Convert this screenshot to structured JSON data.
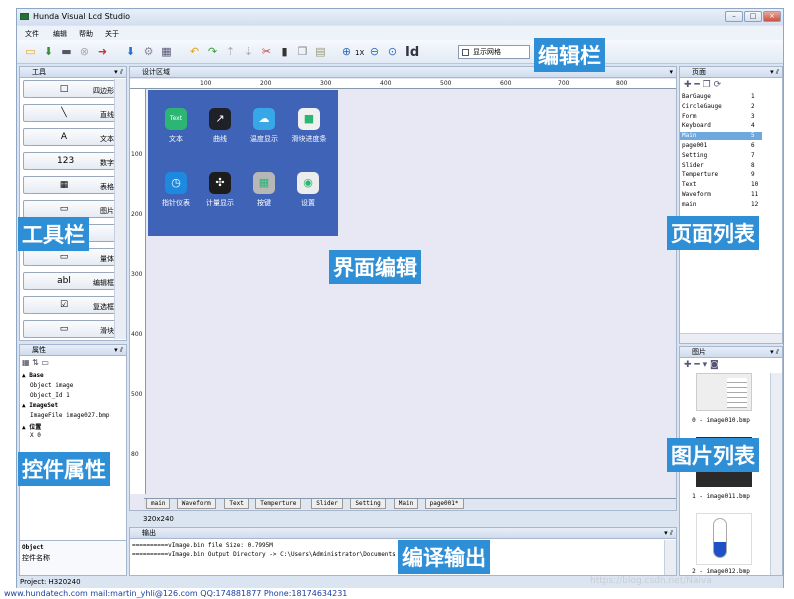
{
  "window": {
    "title": "Hunda Visual Lcd Studio",
    "controls": {
      "minimize": "–",
      "maximize": "□",
      "close": "×"
    }
  },
  "menu": [
    "文件",
    "编辑",
    "帮助",
    "关于"
  ],
  "toolbar": {
    "icons": [
      "new-icon",
      "open-icon",
      "save-icon",
      "close-file-icon",
      "exit-icon",
      "download-icon",
      "settings-icon",
      "calc-icon",
      "undo-icon",
      "redo-icon",
      "move-up-icon",
      "move-down-icon",
      "cut-icon",
      "delete-icon",
      "copy-icon",
      "paste-icon",
      "zoom-in-icon",
      "zoom-reset-icon",
      "zoom-out-icon",
      "zoom-icon",
      "id-icon"
    ],
    "zoom_1x_label": "1X",
    "id_label": "Id",
    "show_grid_label": "显示网格"
  },
  "tool_panel": {
    "title": "工具",
    "tools": [
      {
        "label": "四边形",
        "icon": "□"
      },
      {
        "label": "直线",
        "icon": "╲"
      },
      {
        "label": "文本",
        "icon": "A"
      },
      {
        "label": "数字",
        "icon": "123"
      },
      {
        "label": "表格",
        "icon": "▦"
      },
      {
        "label": "图片",
        "icon": "▭"
      },
      {
        "label": "",
        "icon": ""
      },
      {
        "label": "量体",
        "icon": "▭"
      },
      {
        "label": "编辑框",
        "icon": "abl"
      },
      {
        "label": "复选框",
        "icon": "☑"
      },
      {
        "label": "滑块",
        "icon": "▭"
      }
    ]
  },
  "property_panel": {
    "title": "属性",
    "rows": [
      {
        "text": "▲ Base",
        "bold": true
      },
      {
        "text": "Object      image",
        "bold": false
      },
      {
        "text": "Object_Id 1",
        "bold": false
      },
      {
        "text": "▲ ImageSet",
        "bold": true
      },
      {
        "text": "ImageFile image027.bmp",
        "bold": false
      },
      {
        "text": "▲ 位置",
        "bold": true
      },
      {
        "text": "X          0",
        "bold": false
      }
    ],
    "desc_title": "Object",
    "desc_text": "控件名称"
  },
  "design_area": {
    "title": "设计区域",
    "ruler_h": [
      "100",
      "200",
      "300",
      "400",
      "500",
      "600",
      "700",
      "800"
    ],
    "ruler_v": [
      "100",
      "200",
      "300",
      "400",
      "500",
      "80"
    ],
    "size_label": "320x240",
    "tabs": [
      "main",
      "Waveform",
      "Text",
      "Temperture",
      "Slider",
      "Setting",
      "Main",
      "page001*"
    ]
  },
  "device_apps": [
    {
      "label": "文本",
      "icon": "Text",
      "color": "#2bb673"
    },
    {
      "label": "曲线",
      "icon": "↗",
      "color": "#1e2228"
    },
    {
      "label": "温度显示",
      "icon": "☁",
      "color": "#38a7e8"
    },
    {
      "label": "滑块进度条",
      "icon": "■",
      "color": "#f0f0f0"
    },
    {
      "label": "指针仪表",
      "icon": "◷",
      "color": "#1d8ae0"
    },
    {
      "label": "计量显示",
      "icon": "✣",
      "color": "#1c1c1c"
    },
    {
      "label": "按键",
      "icon": "▦",
      "color": "#b7b7b7"
    },
    {
      "label": "设置",
      "icon": "◉",
      "color": "#ececec"
    }
  ],
  "page_panel": {
    "title": "页面",
    "pages": [
      {
        "name": "BarGauge",
        "index": "1"
      },
      {
        "name": "CircleGauge",
        "index": "2"
      },
      {
        "name": "Form",
        "index": "3"
      },
      {
        "name": "Keyboard",
        "index": "4"
      },
      {
        "name": "Main",
        "index": "5",
        "selected": true
      },
      {
        "name": "page001",
        "index": "6"
      },
      {
        "name": "Setting",
        "index": "7"
      },
      {
        "name": "Slider",
        "index": "8"
      },
      {
        "name": "Temperture",
        "index": "9"
      },
      {
        "name": "Text",
        "index": "10"
      },
      {
        "name": "Waveform",
        "index": "11"
      },
      {
        "name": "main",
        "index": "12"
      }
    ]
  },
  "image_panel": {
    "title": "图片",
    "images": [
      "0 - image010.bmp",
      "1 - image011.bmp",
      "2 - image012.bmp"
    ]
  },
  "output_panel": {
    "title": "输出",
    "lines": [
      "==========vImage.bin file Size: 0.7995M",
      "==========vImage.bin Output Directory -> C:\\Users\\Administrator\\Documents"
    ]
  },
  "status": {
    "project": "Project: H320240"
  },
  "overlays": {
    "edit_bar": "编辑栏",
    "toolbox": "工具栏",
    "ui_edit": "界面编辑",
    "page_list": "页面列表",
    "props": "控件属性",
    "image_list": "图片列表",
    "compile_output": "编译输出"
  },
  "footer": {
    "text": "www.hundatech.com      mail:martin_yhli@126.com      QQ:174881877      Phone:18174634231",
    "watermark": "https://blog.csdn.net/Naiva"
  },
  "colors": {
    "accent": "#2f8fd6",
    "device_bg": "#3f63b7",
    "selected": "#6fa8dc"
  }
}
